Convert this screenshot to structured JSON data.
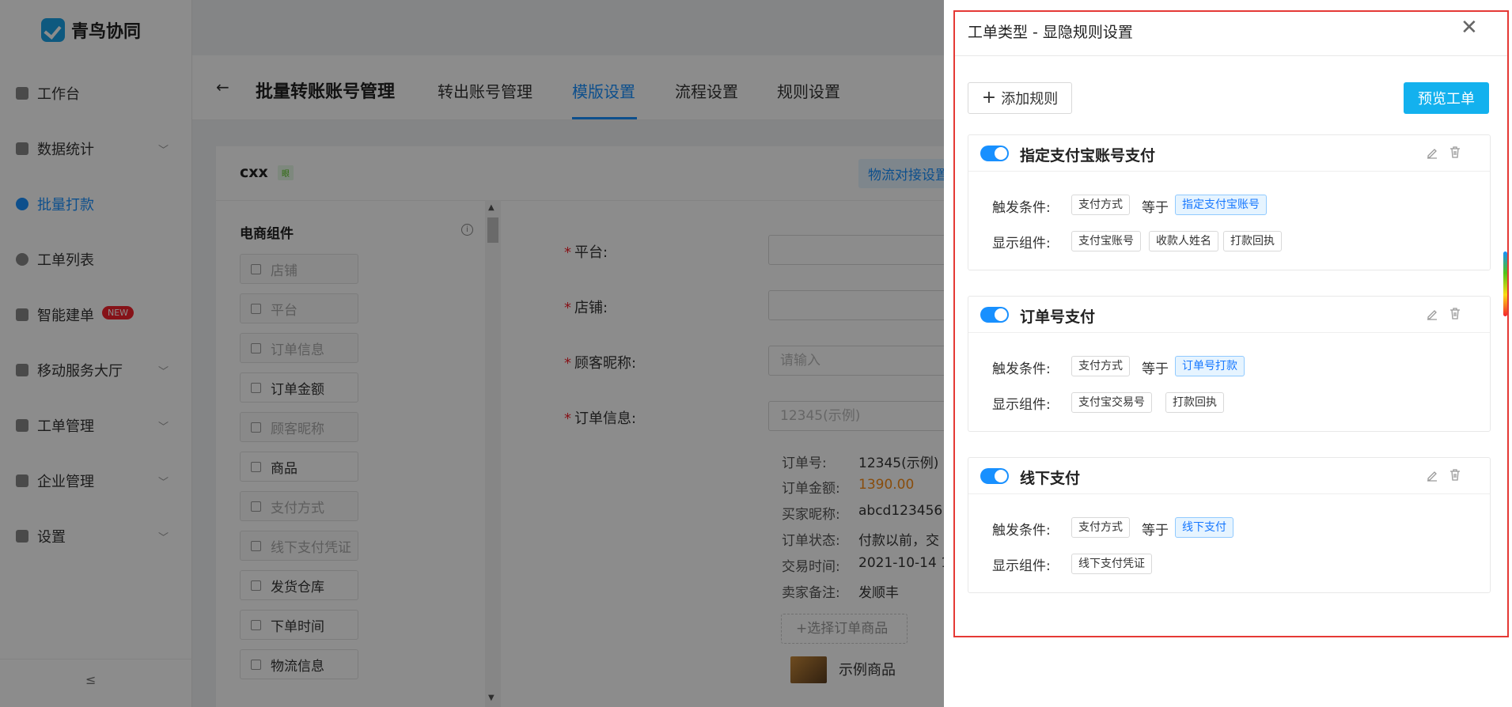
{
  "app": {
    "brand": "青鸟协同"
  },
  "sidebar": {
    "items": [
      {
        "label": "工作台",
        "chevron": false
      },
      {
        "label": "数据统计",
        "chevron": true
      },
      {
        "label": "批量打款",
        "chevron": false,
        "active": true
      },
      {
        "label": "工单列表",
        "chevron": false
      },
      {
        "label": "智能建单",
        "chevron": false,
        "badge": "NEW"
      },
      {
        "label": "移动服务大厅",
        "chevron": true
      },
      {
        "label": "工单管理",
        "chevron": true
      },
      {
        "label": "企业管理",
        "chevron": true
      },
      {
        "label": "设置",
        "chevron": true
      }
    ],
    "collapse_icon": "≤"
  },
  "header": {
    "back": "←",
    "title": "批量转账账号管理",
    "tabs": [
      "转出账号管理",
      "模版设置",
      "流程设置",
      "规则设置"
    ],
    "active_tab": "模版设置"
  },
  "main": {
    "template_name": "cxx",
    "template_tag": "眼",
    "logistics_link": "物流对接设置",
    "components_title": "电商组件",
    "components": [
      {
        "label": "店铺",
        "disabled": true
      },
      {
        "label": "平台",
        "disabled": true
      },
      {
        "label": "订单信息",
        "disabled": true
      },
      {
        "label": "订单金额",
        "disabled": false
      },
      {
        "label": "顾客昵称",
        "disabled": true
      },
      {
        "label": "商品",
        "disabled": false
      },
      {
        "label": "支付方式",
        "disabled": true
      },
      {
        "label": "线下支付凭证",
        "disabled": true
      },
      {
        "label": "发货仓库",
        "disabled": false
      },
      {
        "label": "下单时间",
        "disabled": false
      },
      {
        "label": "物流信息",
        "disabled": false
      }
    ],
    "form": {
      "platform_label": "平台:",
      "shop_label": "店铺:",
      "nickname_label": "顾客昵称:",
      "nickname_placeholder": "请输入",
      "order_label": "订单信息:",
      "order_placeholder": "12345(示例)"
    },
    "order_details": [
      {
        "label": "订单号:",
        "value": "12345(示例)"
      },
      {
        "label": "订单金额:",
        "value": "1390.00"
      },
      {
        "label": "买家昵称:",
        "value": "abcd123456"
      },
      {
        "label": "订单状态:",
        "value": "付款以前，交"
      },
      {
        "label": "交易时间:",
        "value": "2021-10-14 1"
      },
      {
        "label": "卖家备注:",
        "value": "发顺丰"
      }
    ],
    "select_goods": "+选择订单商品",
    "sample_goods": "示例商品"
  },
  "drawer": {
    "title": "工单类型 - 显隐规则设置",
    "add_rule": "添加规则",
    "preview": "预览工单",
    "trigger_label": "触发条件:",
    "display_label": "显示组件:",
    "rules": [
      {
        "name": "指定支付宝账号支付",
        "enabled": true,
        "field": "支付方式",
        "op": "等于",
        "value": "指定支付宝账号",
        "components": [
          "支付宝账号",
          "收款人姓名",
          "打款回执"
        ]
      },
      {
        "name": "订单号支付",
        "enabled": true,
        "field": "支付方式",
        "op": "等于",
        "value": "订单号打款",
        "components": [
          "支付宝交易号",
          "打款回执"
        ]
      },
      {
        "name": "线下支付",
        "enabled": true,
        "field": "支付方式",
        "op": "等于",
        "value": "线下支付",
        "components": [
          "线下支付凭证"
        ]
      }
    ]
  },
  "colors": {
    "accent": "#1890ff",
    "preview_button": "#13b1ee",
    "highlight_frame": "#e53935",
    "money": "#fa8c16"
  }
}
